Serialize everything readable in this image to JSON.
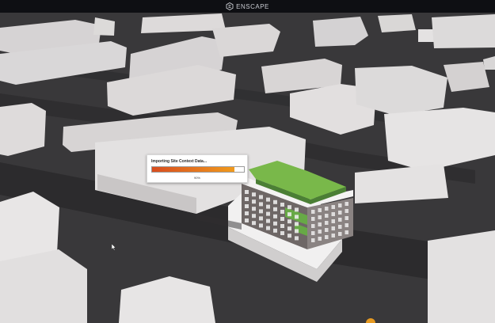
{
  "app": {
    "brand_name": "ENSCAPE",
    "brand_icon": "enscape-logo-icon"
  },
  "dialog": {
    "title": "Importing Site Context Data...",
    "percent_text": "90%",
    "progress": 0.9
  },
  "colors": {
    "titlebar": "#0e0f13",
    "ground": "#3b3a3c",
    "building_light": "#e8e6e7",
    "roof_green": "#79b84a",
    "progress_start": "#d84d1f",
    "progress_end": "#f09a1d"
  }
}
